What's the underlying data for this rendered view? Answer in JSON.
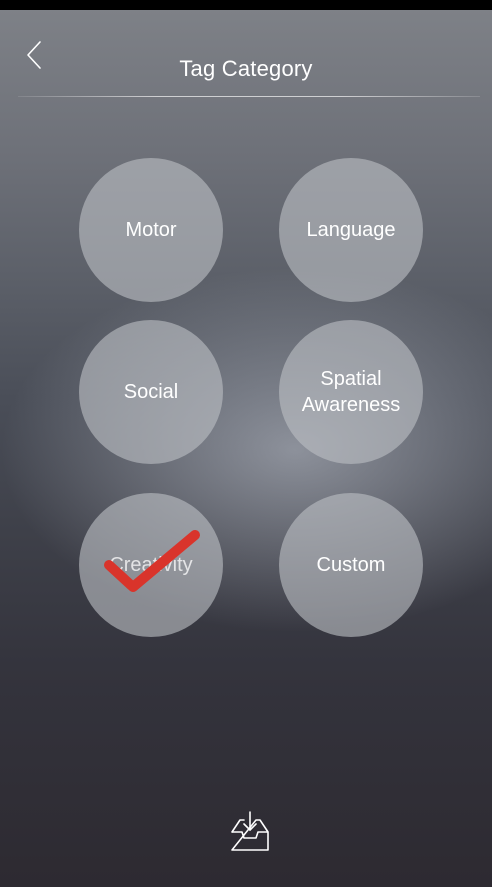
{
  "header": {
    "title": "Tag Category"
  },
  "categories": [
    {
      "label": "Motor",
      "selected": false
    },
    {
      "label": "Language",
      "selected": false
    },
    {
      "label": "Social",
      "selected": false
    },
    {
      "label": "Spatial\nAwareness",
      "selected": false
    },
    {
      "label": "Creativity",
      "selected": true
    },
    {
      "label": "Custom",
      "selected": false
    }
  ],
  "icons": {
    "back": "chevron-left-icon",
    "check": "checkmark-icon",
    "footer": "inbox-download-icon"
  },
  "colors": {
    "checkmark": "#d9342b",
    "text": "#ffffff"
  }
}
